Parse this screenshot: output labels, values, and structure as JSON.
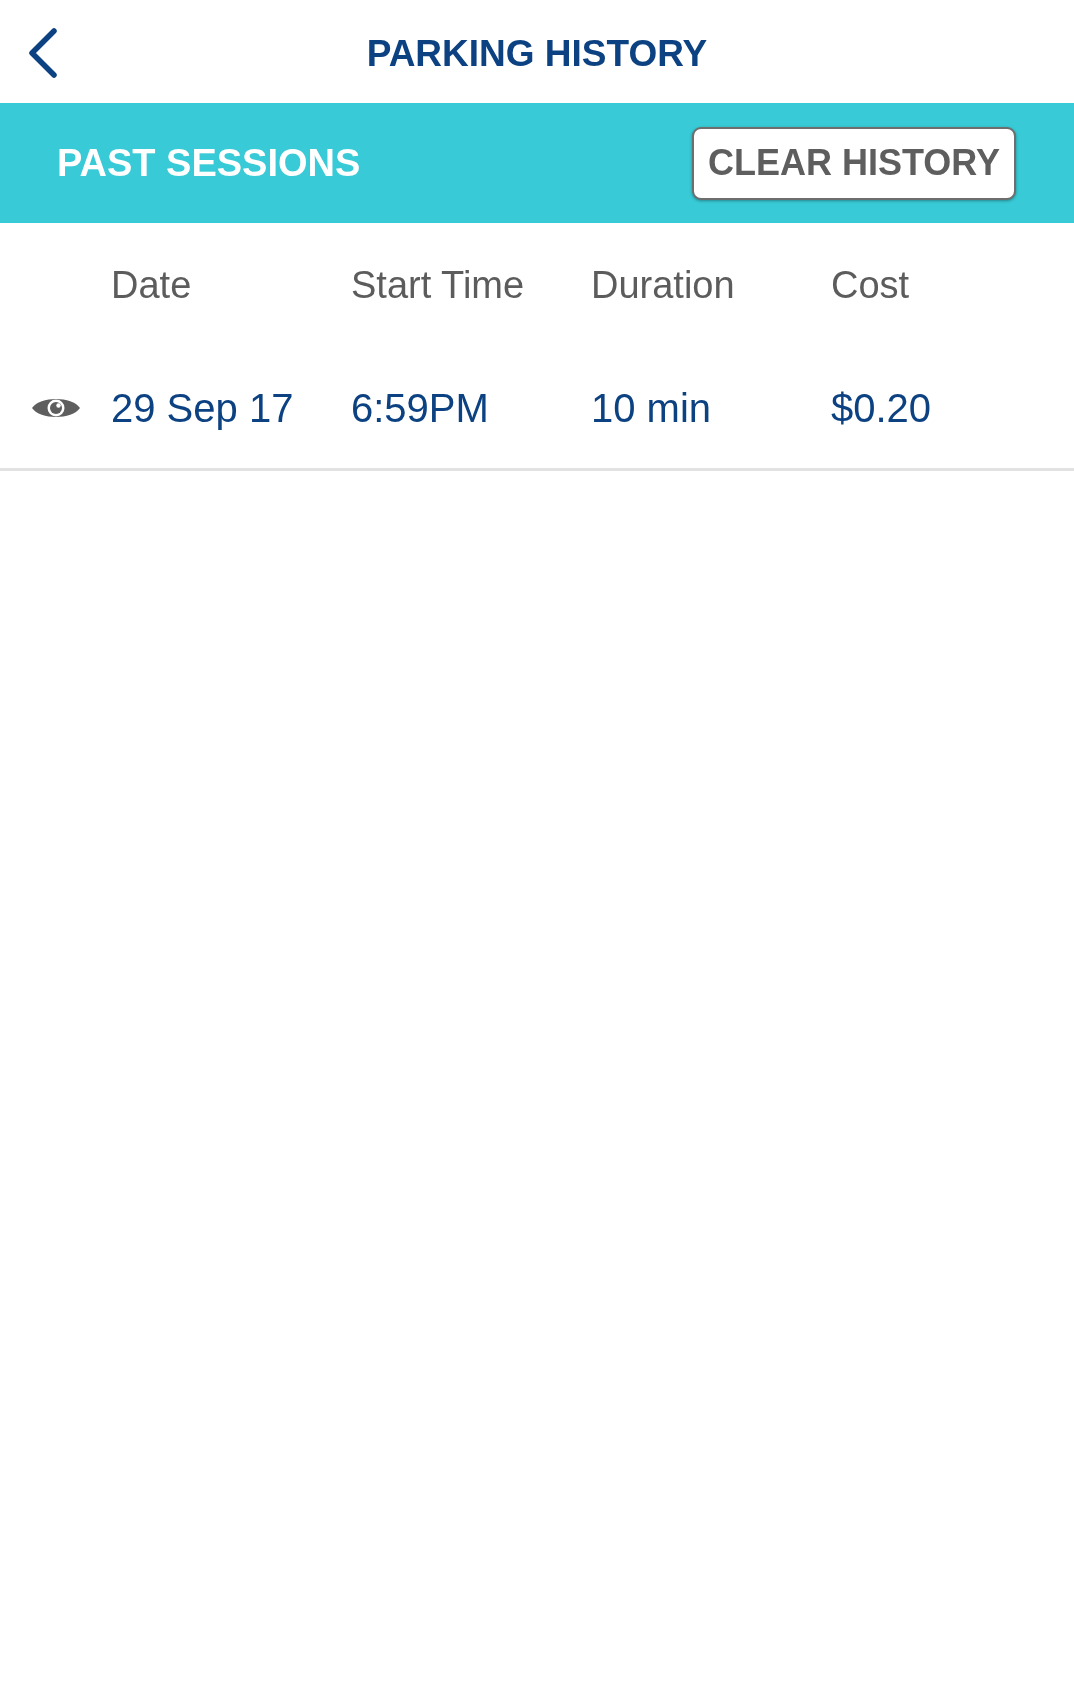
{
  "header": {
    "title": "PARKING HISTORY"
  },
  "section": {
    "title": "PAST SESSIONS",
    "action": "CLEAR HISTORY"
  },
  "table": {
    "columns": [
      "Date",
      "Start Time",
      "Duration",
      "Cost"
    ],
    "rows": [
      {
        "cells": [
          "29 Sep 17",
          "6:59PM",
          "10 min",
          "$0.20"
        ]
      }
    ]
  }
}
